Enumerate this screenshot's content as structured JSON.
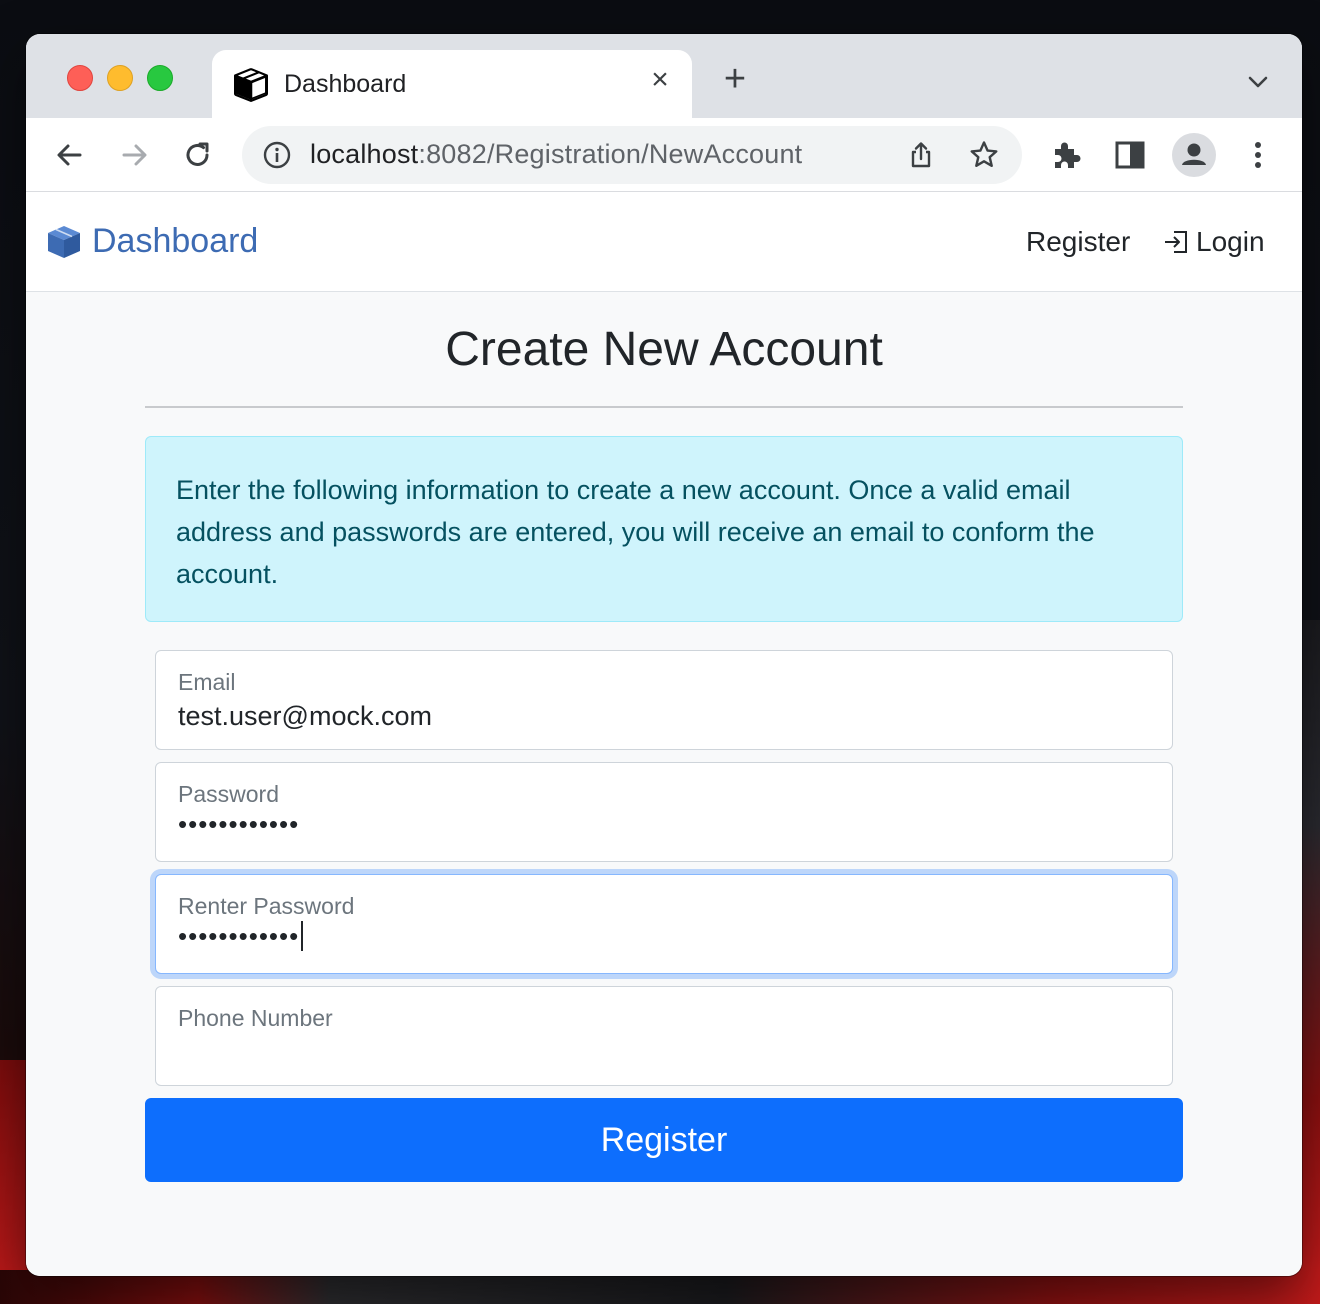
{
  "browser": {
    "tab_title": "Dashboard",
    "close_glyph": "×",
    "new_tab_glyph": "+",
    "url_host": "localhost",
    "url_rest": ":8082/Registration/NewAccount"
  },
  "navbar": {
    "brand": "Dashboard",
    "register_link": "Register",
    "login_link": "Login"
  },
  "page": {
    "heading": "Create New Account",
    "alert_text": "Enter the following information to create a new account. Once a valid email address and passwords are entered, you will receive an email to conform the account."
  },
  "form": {
    "email": {
      "label": "Email",
      "value": "test.user@mock.com"
    },
    "password": {
      "label": "Password",
      "masked": "••••••••••••"
    },
    "renter_password": {
      "label": "Renter Password",
      "masked": "••••••••••••"
    },
    "phone": {
      "label": "Phone Number",
      "value": ""
    },
    "submit": "Register"
  },
  "colors": {
    "brand": "#3d6bb3",
    "primary": "#0d6efd",
    "alert_bg": "#cff4fc",
    "alert_text": "#055160"
  },
  "icons": [
    "box-icon",
    "close-icon",
    "plus-icon",
    "chevron-down-icon",
    "back-arrow-icon",
    "forward-arrow-icon",
    "reload-icon",
    "info-icon",
    "share-icon",
    "star-icon",
    "puzzle-icon",
    "sidepanel-icon",
    "profile-icon",
    "kebab-menu-icon",
    "login-icon"
  ]
}
